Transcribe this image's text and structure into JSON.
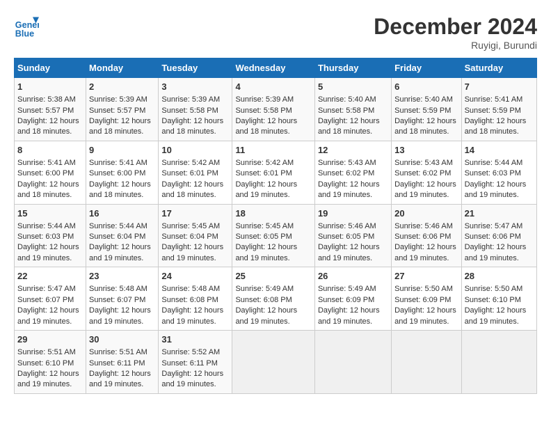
{
  "header": {
    "logo_line1": "General",
    "logo_line2": "Blue",
    "title": "December 2024",
    "subtitle": "Ruyigi, Burundi"
  },
  "days_of_week": [
    "Sunday",
    "Monday",
    "Tuesday",
    "Wednesday",
    "Thursday",
    "Friday",
    "Saturday"
  ],
  "weeks": [
    [
      {
        "day": 1,
        "sunrise": "5:38 AM",
        "sunset": "5:57 PM",
        "daylight": "12 hours and 18 minutes."
      },
      {
        "day": 2,
        "sunrise": "5:39 AM",
        "sunset": "5:57 PM",
        "daylight": "12 hours and 18 minutes."
      },
      {
        "day": 3,
        "sunrise": "5:39 AM",
        "sunset": "5:58 PM",
        "daylight": "12 hours and 18 minutes."
      },
      {
        "day": 4,
        "sunrise": "5:39 AM",
        "sunset": "5:58 PM",
        "daylight": "12 hours and 18 minutes."
      },
      {
        "day": 5,
        "sunrise": "5:40 AM",
        "sunset": "5:58 PM",
        "daylight": "12 hours and 18 minutes."
      },
      {
        "day": 6,
        "sunrise": "5:40 AM",
        "sunset": "5:59 PM",
        "daylight": "12 hours and 18 minutes."
      },
      {
        "day": 7,
        "sunrise": "5:41 AM",
        "sunset": "5:59 PM",
        "daylight": "12 hours and 18 minutes."
      }
    ],
    [
      {
        "day": 8,
        "sunrise": "5:41 AM",
        "sunset": "6:00 PM",
        "daylight": "12 hours and 18 minutes."
      },
      {
        "day": 9,
        "sunrise": "5:41 AM",
        "sunset": "6:00 PM",
        "daylight": "12 hours and 18 minutes."
      },
      {
        "day": 10,
        "sunrise": "5:42 AM",
        "sunset": "6:01 PM",
        "daylight": "12 hours and 18 minutes."
      },
      {
        "day": 11,
        "sunrise": "5:42 AM",
        "sunset": "6:01 PM",
        "daylight": "12 hours and 19 minutes."
      },
      {
        "day": 12,
        "sunrise": "5:43 AM",
        "sunset": "6:02 PM",
        "daylight": "12 hours and 19 minutes."
      },
      {
        "day": 13,
        "sunrise": "5:43 AM",
        "sunset": "6:02 PM",
        "daylight": "12 hours and 19 minutes."
      },
      {
        "day": 14,
        "sunrise": "5:44 AM",
        "sunset": "6:03 PM",
        "daylight": "12 hours and 19 minutes."
      }
    ],
    [
      {
        "day": 15,
        "sunrise": "5:44 AM",
        "sunset": "6:03 PM",
        "daylight": "12 hours and 19 minutes."
      },
      {
        "day": 16,
        "sunrise": "5:44 AM",
        "sunset": "6:04 PM",
        "daylight": "12 hours and 19 minutes."
      },
      {
        "day": 17,
        "sunrise": "5:45 AM",
        "sunset": "6:04 PM",
        "daylight": "12 hours and 19 minutes."
      },
      {
        "day": 18,
        "sunrise": "5:45 AM",
        "sunset": "6:05 PM",
        "daylight": "12 hours and 19 minutes."
      },
      {
        "day": 19,
        "sunrise": "5:46 AM",
        "sunset": "6:05 PM",
        "daylight": "12 hours and 19 minutes."
      },
      {
        "day": 20,
        "sunrise": "5:46 AM",
        "sunset": "6:06 PM",
        "daylight": "12 hours and 19 minutes."
      },
      {
        "day": 21,
        "sunrise": "5:47 AM",
        "sunset": "6:06 PM",
        "daylight": "12 hours and 19 minutes."
      }
    ],
    [
      {
        "day": 22,
        "sunrise": "5:47 AM",
        "sunset": "6:07 PM",
        "daylight": "12 hours and 19 minutes."
      },
      {
        "day": 23,
        "sunrise": "5:48 AM",
        "sunset": "6:07 PM",
        "daylight": "12 hours and 19 minutes."
      },
      {
        "day": 24,
        "sunrise": "5:48 AM",
        "sunset": "6:08 PM",
        "daylight": "12 hours and 19 minutes."
      },
      {
        "day": 25,
        "sunrise": "5:49 AM",
        "sunset": "6:08 PM",
        "daylight": "12 hours and 19 minutes."
      },
      {
        "day": 26,
        "sunrise": "5:49 AM",
        "sunset": "6:09 PM",
        "daylight": "12 hours and 19 minutes."
      },
      {
        "day": 27,
        "sunrise": "5:50 AM",
        "sunset": "6:09 PM",
        "daylight": "12 hours and 19 minutes."
      },
      {
        "day": 28,
        "sunrise": "5:50 AM",
        "sunset": "6:10 PM",
        "daylight": "12 hours and 19 minutes."
      }
    ],
    [
      {
        "day": 29,
        "sunrise": "5:51 AM",
        "sunset": "6:10 PM",
        "daylight": "12 hours and 19 minutes."
      },
      {
        "day": 30,
        "sunrise": "5:51 AM",
        "sunset": "6:11 PM",
        "daylight": "12 hours and 19 minutes."
      },
      {
        "day": 31,
        "sunrise": "5:52 AM",
        "sunset": "6:11 PM",
        "daylight": "12 hours and 19 minutes."
      },
      null,
      null,
      null,
      null
    ]
  ]
}
